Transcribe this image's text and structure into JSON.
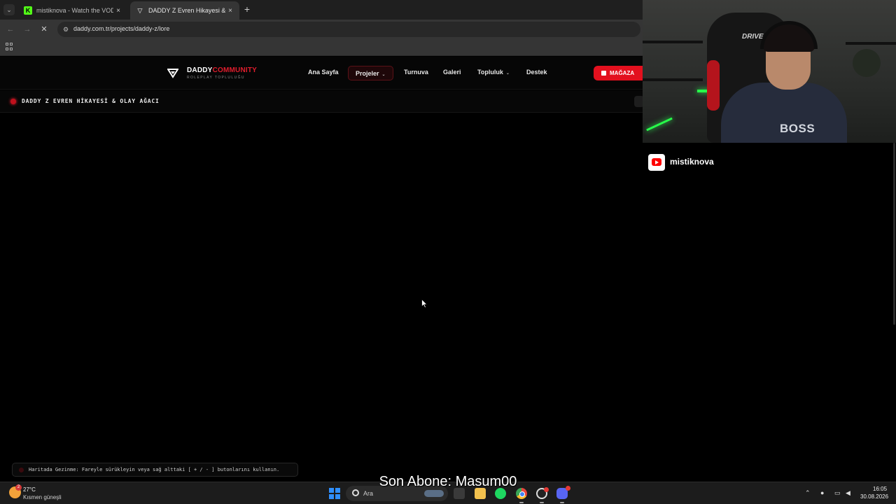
{
  "browser": {
    "tabs": [
      {
        "title": "mistiknova - Watch the VOD on",
        "favicon": "kick-icon",
        "active": false
      },
      {
        "title": "DADDY Z Evren Hikayesi & Wh",
        "favicon": "daddy-logo-icon",
        "active": true
      }
    ],
    "new_tab_label": "+",
    "close_label": "×",
    "url": "daddy.com.tr/projects/daddy-z/lore"
  },
  "site": {
    "brand_main": "DADDY",
    "brand_accent": "COMMUNITY",
    "brand_sub": "ROLEPLAY TOPLULUĞU",
    "nav": [
      {
        "label": "Ana Sayfa"
      },
      {
        "label": "Projeler",
        "active": true,
        "dropdown": true
      },
      {
        "label": "Turnuva"
      },
      {
        "label": "Galeri"
      },
      {
        "label": "Topluluk",
        "dropdown": true
      },
      {
        "label": "Destek"
      }
    ],
    "shop_label": "MAĞAZA",
    "accent_color": "#e3101e"
  },
  "lore": {
    "title": "DADDY Z EVREN HİKAYESİ & OLAY AĞACI",
    "hint": "Haritada Gezinme: Fareyle sürükleyin veya sağ alttaki [ + / - ] butonlarını kullanın."
  },
  "stream": {
    "channel_name": "mistiknova",
    "shirt_text": "BOSS",
    "chair_brand": "DRIVE",
    "last_subscriber": "Son Abone: Masum00"
  },
  "taskbar": {
    "weather_temp": "27°C",
    "weather_desc": "Kısmen güneşli",
    "weather_badge": "2",
    "search_placeholder": "Ara",
    "time": "16:05",
    "date": "30.08.2026",
    "discord_badge": "9+"
  }
}
